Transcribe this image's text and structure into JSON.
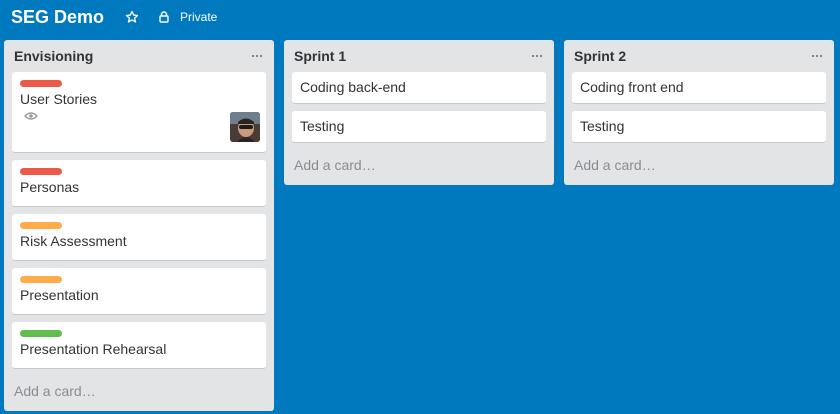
{
  "board": {
    "title": "SEG Demo",
    "privacy": "Private"
  },
  "lists": [
    {
      "title": "Envisioning",
      "cards": [
        {
          "title": "User Stories",
          "label_color": "#eb5a46",
          "watching": true,
          "has_member": true
        },
        {
          "title": "Personas",
          "label_color": "#eb5a46"
        },
        {
          "title": "Risk Assessment",
          "label_color": "#ffab4a"
        },
        {
          "title": "Presentation",
          "label_color": "#ffab4a"
        },
        {
          "title": "Presentation Rehearsal",
          "label_color": "#61bd4f"
        }
      ],
      "add_card": "Add a card…"
    },
    {
      "title": "Sprint 1",
      "cards": [
        {
          "title": "Coding back-end"
        },
        {
          "title": "Testing"
        }
      ],
      "add_card": "Add a card…"
    },
    {
      "title": "Sprint 2",
      "cards": [
        {
          "title": "Coding front end"
        },
        {
          "title": "Testing"
        }
      ],
      "add_card": "Add a card…"
    }
  ],
  "colors": {
    "board_background": "#0079bf",
    "list_background": "#e2e4e6",
    "label_red": "#eb5a46",
    "label_orange": "#ffab4a",
    "label_green": "#61bd4f"
  },
  "icons": {
    "star": "star-icon",
    "lock": "lock-icon",
    "menu": "ellipsis-icon",
    "watch": "eye-icon"
  }
}
